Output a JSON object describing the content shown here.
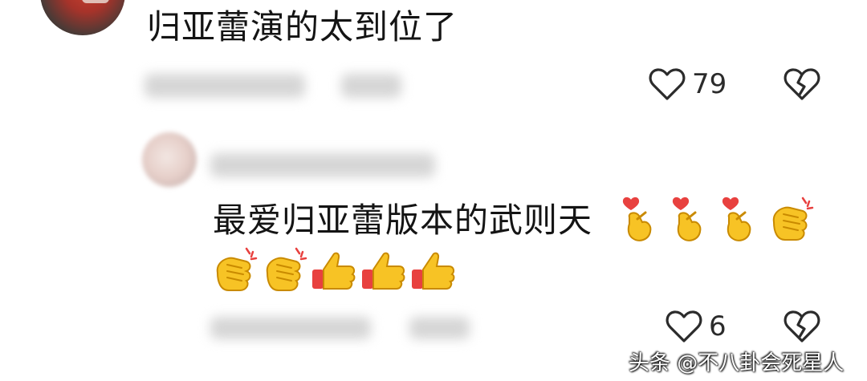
{
  "comments": [
    {
      "text": "归亚蕾演的太到位了",
      "likes": "79"
    },
    {
      "text": "最爱归亚蕾版本的武则天",
      "emojis_line1": [
        "finger-heart",
        "finger-heart",
        "finger-heart",
        "clapping-hands"
      ],
      "emojis_line2": [
        "clapping-hands",
        "clapping-hands",
        "thumbs-up",
        "thumbs-up",
        "thumbs-up"
      ],
      "likes": "6"
    }
  ],
  "watermark": "头条 @不八卦会死星人",
  "icons": {
    "like": "heart-outline-icon",
    "dislike": "broken-heart-icon"
  },
  "colors": {
    "text": "#141414",
    "icon": "#2b2b2b",
    "emoji_yellow": "#f7c325",
    "emoji_red": "#e8413f"
  }
}
